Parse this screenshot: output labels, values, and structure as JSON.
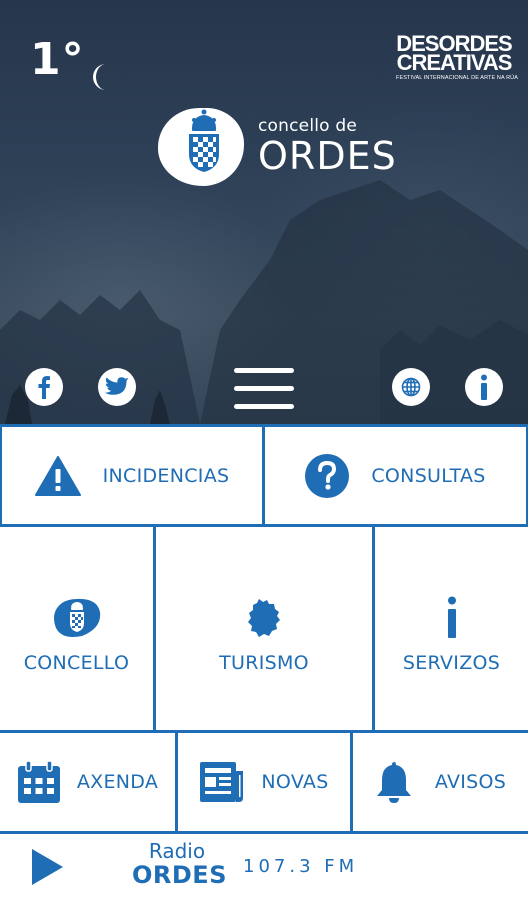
{
  "weather": {
    "temperature": "1°",
    "condition_icon": "moon-icon"
  },
  "festival": {
    "line1": "DESORDES",
    "line2": "CREATIVAS",
    "line3": "FESTIVAL INTERNACIONAL DE ARTE NA RÚA"
  },
  "brand": {
    "subtitle": "concello de",
    "name": "ORDES"
  },
  "social": {
    "facebook_icon": "facebook-icon",
    "twitter_icon": "twitter-icon",
    "web_icon": "globe-icon",
    "info_icon": "info-icon"
  },
  "grid": {
    "incidencias": "INCIDENCIAS",
    "consultas": "CONSULTAS",
    "concello": "CONCELLO",
    "turismo": "TURISMO",
    "servizos": "SERVIZOS",
    "axenda": "AXENDA",
    "novas": "NOVAS",
    "avisos": "AVISOS"
  },
  "radio": {
    "word": "Radio",
    "name": "ORDES",
    "frequency": "107.3 FM"
  },
  "colors": {
    "accent": "#1f6db5",
    "hero": "#2f4258",
    "text_on_dark": "#ffffff"
  }
}
